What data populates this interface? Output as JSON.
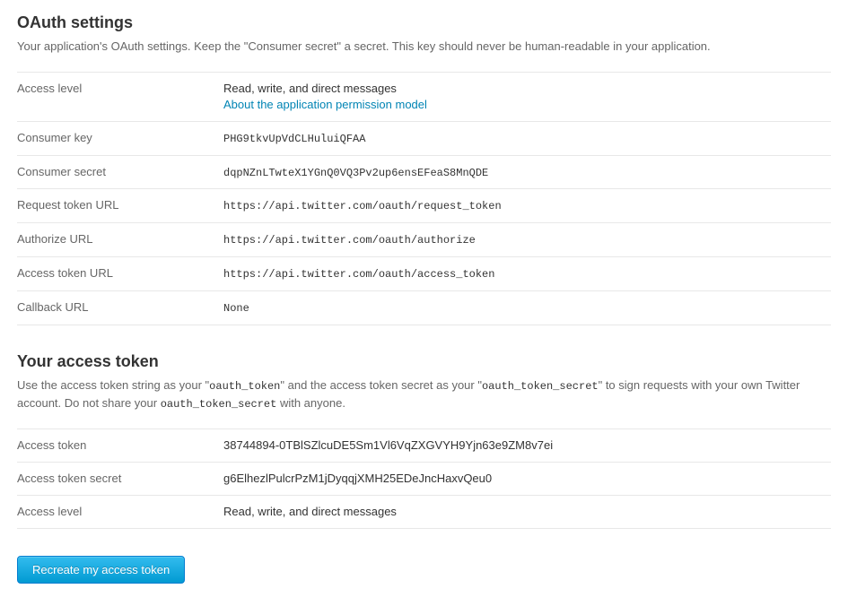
{
  "oauth": {
    "title": "OAuth settings",
    "description": "Your application's OAuth settings. Keep the \"Consumer secret\" a secret. This key should never be human-readable in your application.",
    "rows": {
      "access_level_label": "Access level",
      "access_level_value": "Read, write, and direct messages",
      "permission_link": "About the application permission model",
      "consumer_key_label": "Consumer key",
      "consumer_key_value": "PHG9tkvUpVdCLHuluiQFAA",
      "consumer_secret_label": "Consumer secret",
      "consumer_secret_value": "dqpNZnLTwteX1YGnQ0VQ3Pv2up6ensEFeaS8MnQDE",
      "request_token_label": "Request token URL",
      "request_token_value": "https://api.twitter.com/oauth/request_token",
      "authorize_label": "Authorize URL",
      "authorize_value": "https://api.twitter.com/oauth/authorize",
      "access_token_url_label": "Access token URL",
      "access_token_url_value": "https://api.twitter.com/oauth/access_token",
      "callback_label": "Callback URL",
      "callback_value": "None"
    }
  },
  "token": {
    "title": "Your access token",
    "desc_part1": "Use the access token string as your \"",
    "desc_code1": "oauth_token",
    "desc_part2": "\" and the access token secret as your \"",
    "desc_code2": "oauth_token_secret",
    "desc_part3": "\" to sign requests with your own Twitter account. Do not share your ",
    "desc_code3": "oauth_token_secret",
    "desc_part4": " with anyone.",
    "rows": {
      "access_token_label": "Access token",
      "access_token_value": "38744894-0TBlSZlcuDE5Sm1Vl6VqZXGVYH9Yjn63e9ZM8v7ei",
      "access_token_secret_label": "Access token secret",
      "access_token_secret_value": "g6ElhezlPulcrPzM1jDyqqjXMH25EDeJncHaxvQeu0",
      "access_level_label": "Access level",
      "access_level_value": "Read, write, and direct messages"
    },
    "button_label": "Recreate my access token"
  }
}
